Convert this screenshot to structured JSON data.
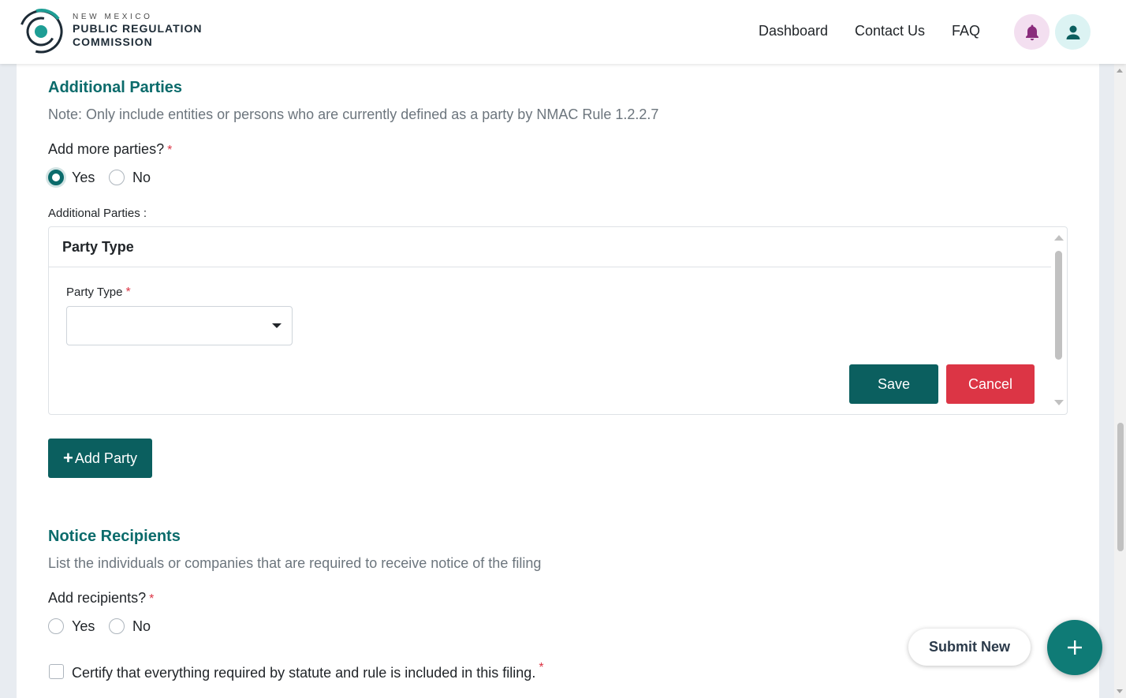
{
  "header": {
    "brand_top": "NEW MEXICO",
    "brand_line1": "PUBLIC REGULATION",
    "brand_line2": "COMMISSION",
    "nav": {
      "dashboard": "Dashboard",
      "contact": "Contact Us",
      "faq": "FAQ"
    },
    "icons": {
      "bell": "bell-icon",
      "user": "user-icon"
    },
    "colors": {
      "brand": "#0b6b6b",
      "bell_bg": "#f3dff0",
      "bell_fg": "#8a2c7c",
      "user_bg": "#dcf3f3",
      "user_fg": "#0b5f5f"
    }
  },
  "additional_parties": {
    "title": "Additional Parties",
    "note": "Note: Only include entities or persons who are currently defined as a party by NMAC Rule 1.2.2.7",
    "question": "Add more parties?",
    "required_mark": "*",
    "options": {
      "yes": "Yes",
      "no": "No"
    },
    "selected": "Yes",
    "field_label": "Additional Parties :",
    "panel": {
      "title": "Party Type",
      "select_label": "Party Type",
      "select_value": "",
      "save": "Save",
      "cancel": "Cancel"
    },
    "add_button": "Add Party"
  },
  "notice_recipients": {
    "title": "Notice Recipients",
    "description": "List the individuals or companies that are required to receive notice of the filing",
    "question": "Add recipients?",
    "required_mark": "*",
    "options": {
      "yes": "Yes",
      "no": "No"
    },
    "selected": ""
  },
  "certify": {
    "text": "Certify that everything required by statute and rule is included in this filing.",
    "required_mark": "*",
    "checked": false
  },
  "floating": {
    "submit_new": "Submit New",
    "fab_icon": "plus-icon"
  },
  "colors": {
    "primary": "#0b5f5f",
    "danger": "#dc3545",
    "heading": "#0b6b6b"
  }
}
